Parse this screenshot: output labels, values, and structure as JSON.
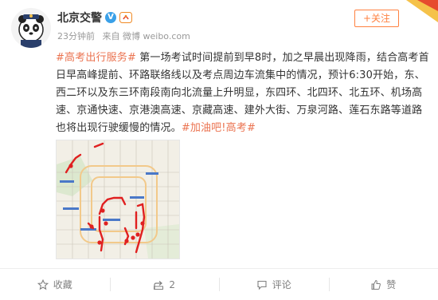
{
  "post": {
    "author": "北京交警",
    "follow_label": "+关注",
    "time": "23分钟前",
    "source": "来自 微博 weibo.com",
    "content_parts": [
      {
        "text": "#高考出行服务#",
        "topic": true
      },
      {
        "text": " 第一场考试时间提前到早8时，加之早晨出现降雨，结合高考首日早高峰提前、环路联络线以及考点周边车流集中的情况，预计6:30开始，东、西二环以及东三环南段南向北流量上升明显，东四环、北四环、北五环、机场高速、京通快速、京港澳高速、京藏高速、建外大街、万泉河路、莲石东路等道路也将出现行驶缓慢的情况。",
        "topic": false
      },
      {
        "text": "#加油吧!高考#",
        "topic": true
      }
    ]
  },
  "actions": {
    "collect_label": "收藏",
    "share_count": "2",
    "comment_label": "评论",
    "like_label": "赞"
  },
  "colors": {
    "topic": "#eb7350",
    "follow": "#ff8140",
    "verified": "#3aa0e8",
    "congestion": "#e02020"
  },
  "icons": [
    "avatar-panda",
    "verified-icon",
    "gov-badge-icon",
    "collect-icon",
    "share-icon",
    "comment-icon",
    "like-icon"
  ]
}
